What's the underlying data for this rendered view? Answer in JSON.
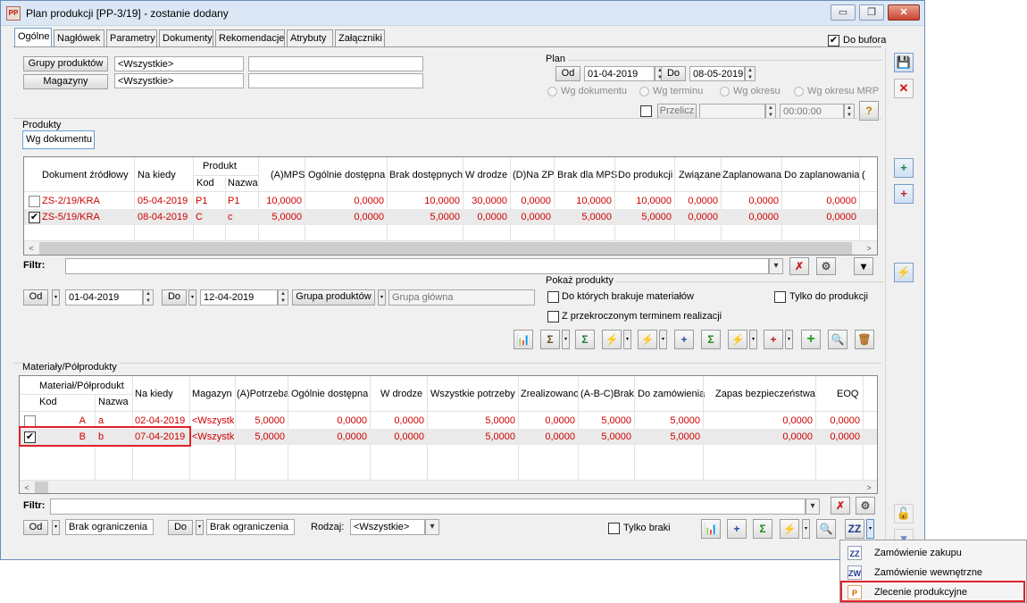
{
  "window": {
    "title": "Plan produkcji [PP-3/19] - zostanie dodany",
    "app_icon": "PP",
    "minimize": "▭",
    "restore": "❐",
    "close": "✕"
  },
  "tabs": [
    "Ogólne",
    "Nagłówek",
    "Parametry",
    "Dokumenty",
    "Rekomendacje",
    "Atrybuty",
    "Załączniki"
  ],
  "do_bufora": {
    "label": "Do bufora",
    "checked": true,
    "mark": "✔"
  },
  "filters_top": {
    "grupy_btn": "Grupy produktów",
    "grupy_value": "<Wszystkie>",
    "magazyny_btn": "Magazyny",
    "magazyny_value": "<Wszystkie>"
  },
  "plan": {
    "title": "Plan",
    "od_btn": "Od",
    "od_value": "01-04-2019",
    "do_btn": "Do",
    "do_value": "08-05-2019",
    "radios": [
      "Wg dokumentu",
      "Wg terminu",
      "Wg okresu",
      "Wg okresu MRP"
    ],
    "przelicz": "Przelicz",
    "time": "00:00:00"
  },
  "produkty": {
    "section_label": "Produkty",
    "subtab": "Wg dokumentu",
    "group_header": "Produkt",
    "headers": [
      "Dokument źródłowy",
      "Na kiedy",
      "Kod",
      "Nazwa",
      "(A)MPS",
      "Ogólnie dostępna",
      "Brak dostępnych",
      "W drodze",
      "(D)Na ZP",
      "Brak dla MPS",
      "Do produkcji",
      "Związane",
      "Zaplanowana",
      "Do zaplanowania",
      "("
    ],
    "rows": [
      {
        "check": "",
        "cells": [
          "ZS-2/19/KRA",
          "05-04-2019",
          "P1",
          "P1",
          "10,0000",
          "0,0000",
          "10,0000",
          "30,0000",
          "0,0000",
          "10,0000",
          "10,0000",
          "0,0000",
          "0,0000",
          "0,0000"
        ]
      },
      {
        "check": "✔",
        "cells": [
          "ZS-5/19/KRA",
          "08-04-2019",
          "C",
          "c",
          "5,0000",
          "0,0000",
          "5,0000",
          "0,0000",
          "0,0000",
          "5,0000",
          "5,0000",
          "0,0000",
          "0,0000",
          "0,0000"
        ]
      }
    ],
    "filter_label": "Filtr:",
    "od_btn": "Od",
    "od_value": "01-04-2019",
    "do_btn": "Do",
    "do_value": "12-04-2019",
    "grupa_btn": "Grupa produktów",
    "grupa_value": "Grupa główna",
    "pokaz_title": "Pokaż produkty",
    "opt_brakuje": "Do których brakuje materiałów",
    "opt_tylko": "Tylko do produkcji",
    "opt_przekroczony": "Z przekroczonym terminem realizacji"
  },
  "materialy": {
    "section_label": "Materiały/Półprodukty",
    "group_header": "Materiał/Półprodukt",
    "headers": [
      "Kod",
      "Nazwa",
      "Na kiedy",
      "Magazyn",
      "(A)Potrzeba",
      "Ogólnie dostępna",
      "W drodze",
      "Wszystkie potrzeby",
      "Zrealizowano",
      "(A-B-C)Brak",
      "Do zamówienia",
      "Zapas bezpieczeństwa",
      "EOQ"
    ],
    "rows": [
      {
        "check": "",
        "cells": [
          "A",
          "a",
          "02-04-2019",
          "<Wszystk",
          "5,0000",
          "0,0000",
          "0,0000",
          "5,0000",
          "0,0000",
          "5,0000",
          "5,0000",
          "0,0000",
          "0,0000"
        ]
      },
      {
        "check": "✔",
        "cells": [
          "B",
          "b",
          "07-04-2019",
          "<Wszystk",
          "5,0000",
          "0,0000",
          "0,0000",
          "5,0000",
          "0,0000",
          "5,0000",
          "5,0000",
          "0,0000",
          "0,0000"
        ]
      }
    ],
    "filter_label": "Filtr:",
    "od_btn": "Od",
    "od_value": "Brak ograniczenia",
    "do_btn": "Do",
    "do_value": "Brak ograniczenia",
    "rodzaj_label": "Rodzaj:",
    "rodzaj_value": "<Wszystkie>",
    "tylko_braki": "Tylko braki"
  },
  "context_menu": {
    "items": [
      {
        "label": "Zamówienie zakupu",
        "icon": "ZZ"
      },
      {
        "label": "Zamówienie wewnętrzne",
        "icon": "ZW"
      },
      {
        "label": "Zlecenie produkcyjne",
        "icon": "P"
      }
    ]
  },
  "icons": {
    "dropdown": "▾",
    "spin_up": "▲",
    "spin_down": "▼",
    "scroll_left": "<",
    "scroll_right": ">",
    "save": "💾",
    "cancel": "✕",
    "help": "?",
    "sum": "Σ",
    "plus": "+",
    "search": "🔍",
    "trash": "🗑",
    "lightning": "⚡",
    "lock": "🔓",
    "chart": "📊",
    "filter_clear": "✗",
    "filter_build": "⚙"
  },
  "colors": {
    "row_text": "#d00000",
    "highlight_frame": "#e0212a",
    "title_bar": "#dbe7f5"
  }
}
